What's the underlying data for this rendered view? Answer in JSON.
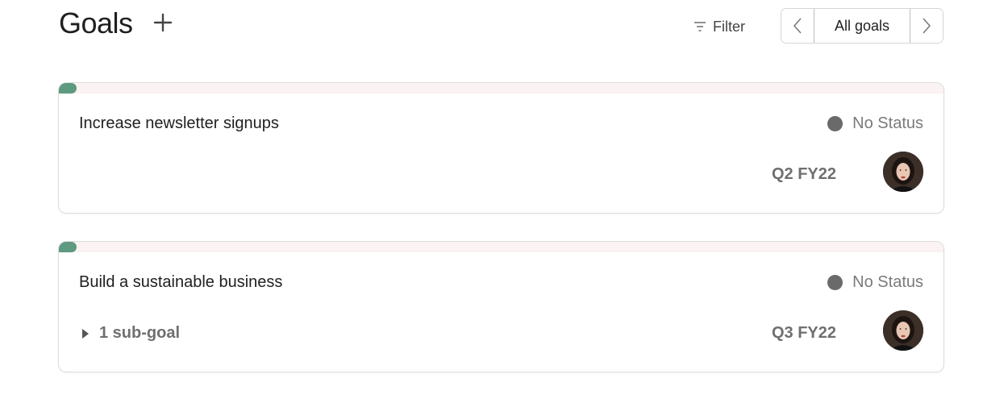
{
  "header": {
    "title": "Goals",
    "filter_label": "Filter",
    "pager_label": "All goals"
  },
  "goals": [
    {
      "title": "Increase newsletter signups",
      "status": "No Status",
      "period": "Q2 FY22",
      "progress": 0.02
    },
    {
      "title": "Build a sustainable business",
      "status": "No Status",
      "period": "Q3 FY22",
      "subgoals": "1 sub-goal",
      "progress": 0.02
    }
  ],
  "colors": {
    "progress_fill": "#5d9a80",
    "progress_track": "#faf2f3",
    "status_dot": "#6a6a6a"
  },
  "icons": {
    "add": "plus-icon",
    "filter": "filter-icon",
    "prev": "chevron-left-icon",
    "next": "chevron-right-icon",
    "expand": "caret-right-icon"
  }
}
